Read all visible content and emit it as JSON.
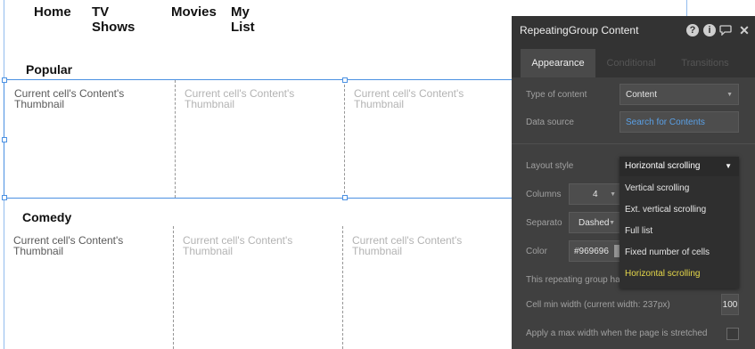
{
  "nav": {
    "items": [
      "Home",
      "TV Shows",
      "Movies",
      "My List"
    ]
  },
  "sections": [
    {
      "title": "Popular",
      "cells": [
        "Current cell's Content's Thumbnail",
        "Current cell's Content's Thumbnail",
        "Current cell's Content's Thumbnail"
      ]
    },
    {
      "title": "Comedy",
      "cells": [
        "Current cell's Content's Thumbnail",
        "Current cell's Content's Thumbnail",
        "Current cell's Content's Thumbnail"
      ]
    }
  ],
  "panel": {
    "title": "RepeatingGroup Content",
    "tabs": [
      "Appearance",
      "Conditional",
      "Transitions"
    ],
    "type_of_content_label": "Type of content",
    "type_of_content_value": "Content",
    "data_source_label": "Data source",
    "data_source_value": "Search for Contents",
    "layout_style_label": "Layout style",
    "layout_style_value": "Horizontal scrolling",
    "columns_label": "Columns",
    "columns_value": "4",
    "separator_label": "Separato",
    "separator_value": "Dashed",
    "color_label": "Color",
    "color_value": "#969696",
    "note_text": "This repeating group ha",
    "cell_min_width_label": "Cell min width (current width: 237px)",
    "cell_min_width_value": "100",
    "max_width_label": "Apply a max width when the page is stretched"
  },
  "layout_dropdown": {
    "selected": "Horizontal scrolling",
    "options": [
      "Vertical scrolling",
      "Ext. vertical scrolling",
      "Full list",
      "Fixed number of cells",
      "Horizontal scrolling"
    ]
  },
  "icons": {
    "help": "question-icon",
    "info": "info-icon",
    "comment": "comment-icon",
    "close": "close-icon"
  },
  "colors": {
    "accent": "#4a90e2",
    "panel_bg": "#404040",
    "highlight": "#e6d84a",
    "separator": "#969696"
  }
}
